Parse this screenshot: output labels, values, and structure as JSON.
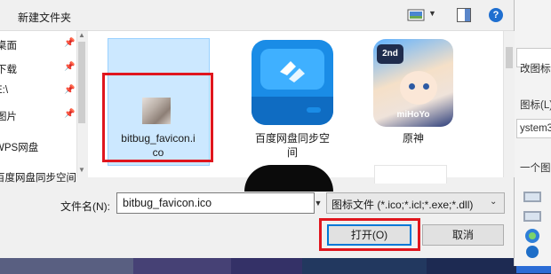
{
  "toolbar": {
    "new_folder_label": "新建文件夹",
    "help_label": "?"
  },
  "nav": {
    "items": [
      {
        "label": "桌面",
        "pinned": true
      },
      {
        "label": "下载",
        "pinned": true
      },
      {
        "label": "E:\\",
        "pinned": true
      },
      {
        "label": "图片",
        "pinned": true
      },
      {
        "label": "WPS网盘",
        "pinned": false
      },
      {
        "label": "百度网盘同步空间",
        "pinned": false
      }
    ],
    "pin_icon": "pin-icon"
  },
  "files": [
    {
      "name_line1": "bitbug_favicon.i",
      "name_line2": "co",
      "selected": true,
      "icon": "image-thumbnail-icon"
    },
    {
      "name_line1": "百度网盘同步空",
      "name_line2": "间",
      "selected": false,
      "icon": "cloud-sync-icon"
    },
    {
      "name_line1": "原神",
      "name_line2": "",
      "selected": false,
      "icon": "game-app-icon",
      "badge": "2nd",
      "brand": "miHoYo"
    }
  ],
  "filename": {
    "label": "文件名(N):",
    "value": "bitbug_favicon.ico"
  },
  "filetype": {
    "selected": "图标文件 (*.ico;*.icl;*.exe;*.dll)"
  },
  "buttons": {
    "open_label": "打开(O)",
    "cancel_label": "取消"
  },
  "background_window": {
    "texts": [
      "改图标",
      "图标(L):",
      "ystem3",
      "一个图"
    ]
  },
  "colors": {
    "highlight_red": "#e0161e",
    "selection_blue": "#cce8ff",
    "accent": "#0078d7"
  }
}
